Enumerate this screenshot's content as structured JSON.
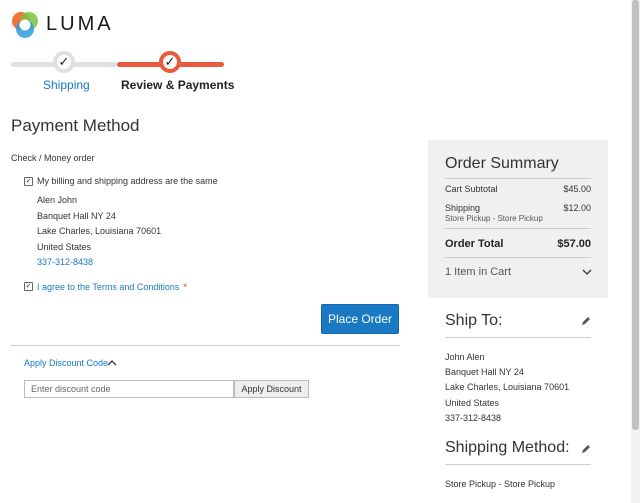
{
  "brand": {
    "name": "LUMA",
    "icon": "luma-logo-icon"
  },
  "progress": {
    "steps": [
      {
        "label": "Shipping",
        "state": "complete",
        "icon": "check-icon"
      },
      {
        "label": "Review & Payments",
        "state": "current",
        "icon": "check-icon"
      }
    ],
    "colors": {
      "complete": "#e0e0e0",
      "current": "#e85a3c",
      "link": "#1979c3"
    }
  },
  "payment": {
    "title": "Payment Method",
    "method_name": "Check / Money order",
    "same_address_label": "My billing and shipping address are the same",
    "same_address_checked": true,
    "address": {
      "name": "Alen John",
      "street": "Banquet Hall NY 24",
      "city_line": "Lake Charles, Louisiana 70601",
      "country": "United States",
      "phone": "337-312-8438"
    },
    "terms_label": "I agree to the Terms and Conditions",
    "terms_required_mark": "*",
    "terms_checked": true,
    "place_order_label": "Place Order"
  },
  "discount": {
    "toggle_label": "Apply Discount Code",
    "input_placeholder": "Enter discount code",
    "apply_label": "Apply Discount"
  },
  "summary": {
    "title": "Order Summary",
    "subtotal_label": "Cart Subtotal",
    "subtotal_value": "$45.00",
    "shipping_label": "Shipping",
    "shipping_value": "$12.00",
    "shipping_method": "Store Pickup - Store Pickup",
    "total_label": "Order Total",
    "total_value": "$57.00",
    "items_label": "1 Item in Cart"
  },
  "ship_to": {
    "title": "Ship To:",
    "name": "John Alen",
    "street": "Banquet Hall NY 24",
    "city_line": "Lake Charles, Louisiana 70601",
    "country": "United States",
    "phone": "337-312-8438"
  },
  "shipping_method": {
    "title": "Shipping Method:",
    "value": "Store Pickup - Store Pickup"
  }
}
